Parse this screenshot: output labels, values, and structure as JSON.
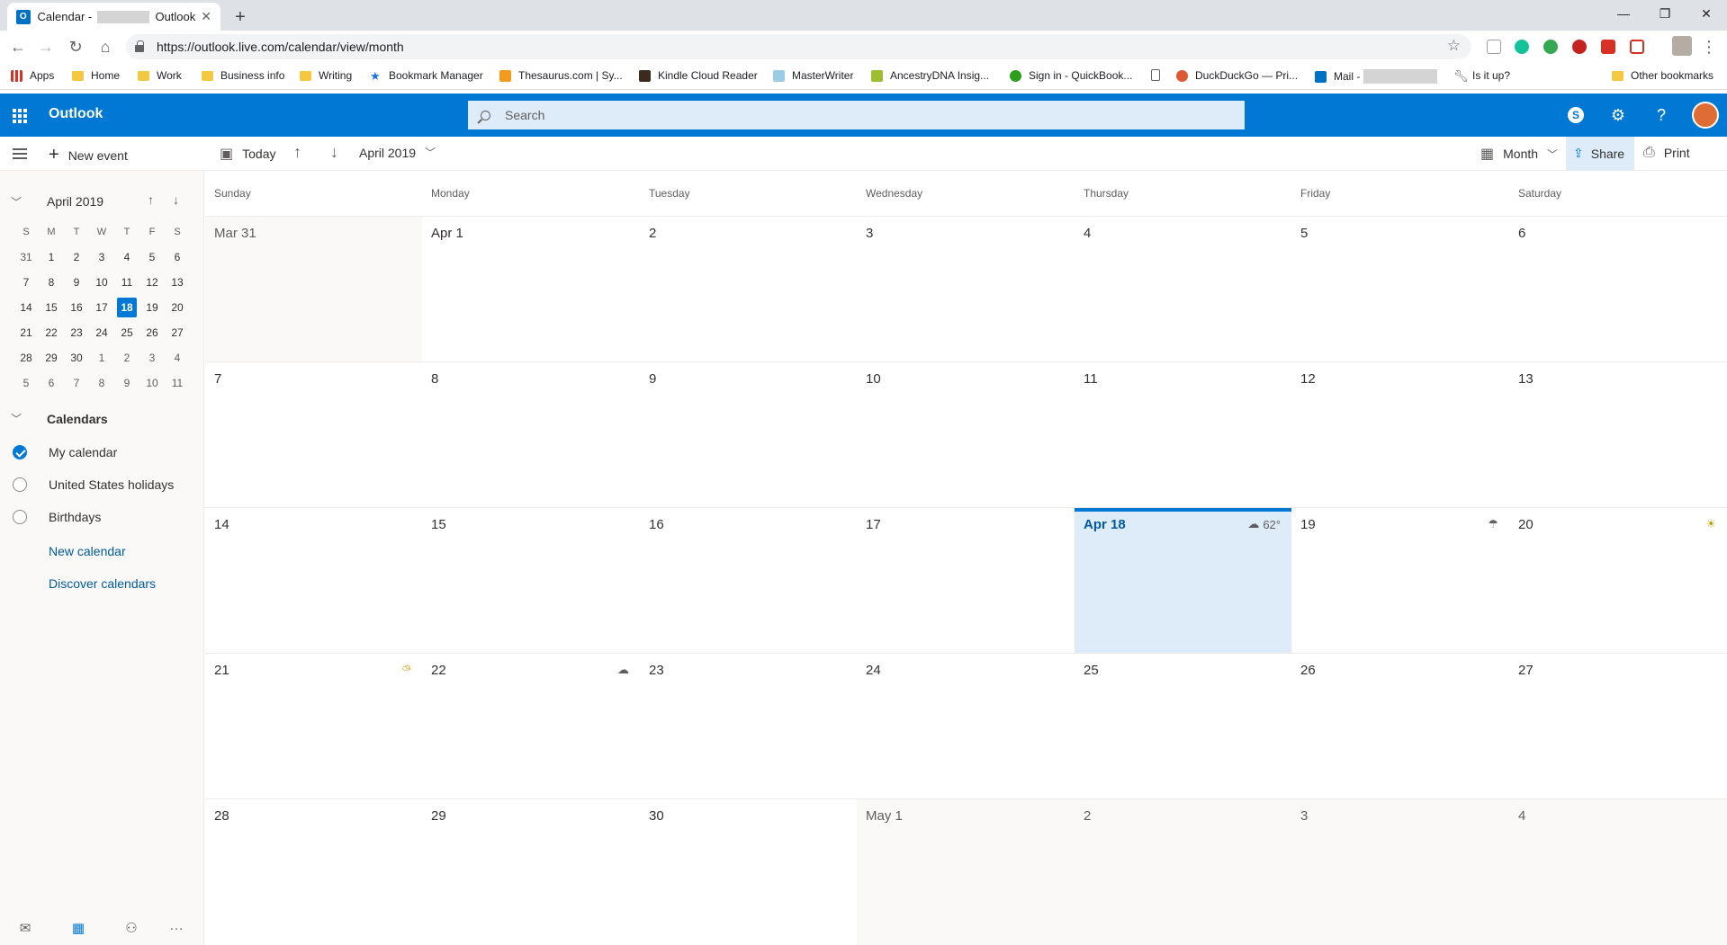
{
  "browser": {
    "tab_title_prefix": "Calendar -",
    "tab_title_suffix": "Outlook",
    "url": "https://outlook.live.com/calendar/view/month",
    "bookmarks": [
      {
        "label": "Apps",
        "icon": "apps-grid-icon"
      },
      {
        "label": "Home",
        "icon": "folder-icon"
      },
      {
        "label": "Work",
        "icon": "folder-icon"
      },
      {
        "label": "Business info",
        "icon": "folder-icon"
      },
      {
        "label": "Writing",
        "icon": "folder-icon"
      },
      {
        "label": "Bookmark Manager",
        "icon": "star-icon"
      },
      {
        "label": "Thesaurus.com | Sy...",
        "icon": "thesaurus-icon"
      },
      {
        "label": "Kindle Cloud Reader",
        "icon": "kindle-icon"
      },
      {
        "label": "MasterWriter",
        "icon": "masterwriter-icon"
      },
      {
        "label": "AncestryDNA Insig...",
        "icon": "ancestry-icon"
      },
      {
        "label": "Sign in - QuickBook...",
        "icon": "quickbooks-icon"
      },
      {
        "label": "",
        "icon": "page-icon"
      },
      {
        "label": "DuckDuckGo — Pri...",
        "icon": "duckduckgo-icon"
      },
      {
        "label": "Mail -",
        "icon": "outlook-icon"
      },
      {
        "label": "Is it up?",
        "icon": "wrench-icon"
      }
    ],
    "other_bookmarks": "Other bookmarks"
  },
  "outlook": {
    "brand": "Outlook",
    "search_placeholder": "Search"
  },
  "commandbar": {
    "new_event": "New event",
    "today": "Today",
    "current_period": "April 2019",
    "view": "Month",
    "share": "Share",
    "print": "Print"
  },
  "mini_calendar": {
    "title": "April 2019",
    "weekday_headers": [
      "S",
      "M",
      "T",
      "W",
      "T",
      "F",
      "S"
    ],
    "weeks": [
      [
        "31",
        "1",
        "2",
        "3",
        "4",
        "5",
        "6"
      ],
      [
        "7",
        "8",
        "9",
        "10",
        "11",
        "12",
        "13"
      ],
      [
        "14",
        "15",
        "16",
        "17",
        "18",
        "19",
        "20"
      ],
      [
        "21",
        "22",
        "23",
        "24",
        "25",
        "26",
        "27"
      ],
      [
        "28",
        "29",
        "30",
        "1",
        "2",
        "3",
        "4"
      ],
      [
        "5",
        "6",
        "7",
        "8",
        "9",
        "10",
        "11"
      ]
    ],
    "selected_day": "18"
  },
  "calendars": {
    "header": "Calendars",
    "items": [
      {
        "label": "My calendar",
        "checked": true
      },
      {
        "label": "United States holidays",
        "checked": false
      },
      {
        "label": "Birthdays",
        "checked": false
      }
    ],
    "new_calendar": "New calendar",
    "discover_calendars": "Discover calendars"
  },
  "month_view": {
    "weekdays": [
      "Sunday",
      "Monday",
      "Tuesday",
      "Wednesday",
      "Thursday",
      "Friday",
      "Saturday"
    ],
    "weeks": [
      [
        "Mar 31",
        "Apr 1",
        "2",
        "3",
        "4",
        "5",
        "6"
      ],
      [
        "7",
        "8",
        "9",
        "10",
        "11",
        "12",
        "13"
      ],
      [
        "14",
        "15",
        "16",
        "17",
        "Apr 18",
        "19",
        "20"
      ],
      [
        "21",
        "22",
        "23",
        "24",
        "25",
        "26",
        "27"
      ],
      [
        "28",
        "29",
        "30",
        "May 1",
        "2",
        "3",
        "4"
      ]
    ],
    "today_weather": "62°"
  }
}
